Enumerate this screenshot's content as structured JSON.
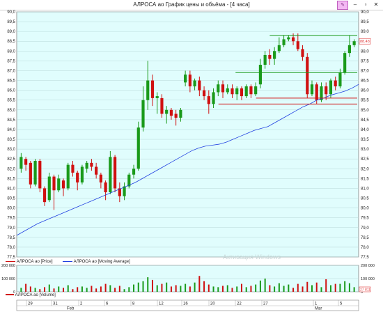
{
  "window": {
    "title": "АЛРОСА ао График цены и объёма - [4 часа]",
    "pin_icon": "pencil-icon",
    "controls": [
      "minimize-icon",
      "restore-icon",
      "close-icon"
    ]
  },
  "colors": {
    "background": "#e0fdfd",
    "bull": "#1a9a1a",
    "bear": "#d01010",
    "ma": "#2040e0",
    "level_green": "#1a9a1a",
    "level_red": "#d01010"
  },
  "chart_data": {
    "type": "candlestick",
    "ylim": [
      77.5,
      90.0
    ],
    "yticks": [
      "90,0",
      "89,5",
      "89,0",
      "88,5",
      "88,0",
      "87,5",
      "87,0",
      "86,5",
      "86,0",
      "85,5",
      "85,0",
      "84,5",
      "84,0",
      "83,5",
      "83,0",
      "82,5",
      "82,0",
      "81,5",
      "81,0",
      "80,5",
      "80,0",
      "79,5",
      "79,0",
      "78,5",
      "78,0",
      "77,5"
    ],
    "last_price_label": "88,48",
    "candles": [
      [
        82.0,
        82.6,
        82.8,
        81.8
      ],
      [
        82.5,
        82.2,
        82.6,
        81.9
      ],
      [
        82.3,
        81.2,
        82.4,
        81.0
      ],
      [
        81.2,
        82.4,
        82.5,
        81.1
      ],
      [
        82.4,
        81.0,
        82.5,
        80.8
      ],
      [
        81.0,
        80.3,
        81.1,
        80.1
      ],
      [
        80.4,
        81.6,
        81.8,
        80.3
      ],
      [
        81.6,
        80.9,
        81.7,
        79.9
      ],
      [
        80.9,
        81.5,
        81.7,
        80.8
      ],
      [
        81.4,
        81.0,
        81.5,
        80.6
      ],
      [
        81.0,
        82.2,
        82.3,
        80.9
      ],
      [
        82.2,
        81.8,
        82.4,
        81.6
      ],
      [
        81.8,
        81.3,
        81.9,
        80.9
      ],
      [
        81.3,
        82.1,
        82.2,
        81.2
      ],
      [
        82.0,
        82.3,
        82.4,
        81.8
      ],
      [
        82.3,
        82.1,
        82.5,
        81.9
      ],
      [
        82.1,
        81.7,
        82.3,
        81.5
      ],
      [
        81.7,
        81.3,
        81.8,
        81.0
      ],
      [
        81.3,
        80.8,
        81.4,
        80.4
      ],
      [
        80.8,
        82.6,
        82.9,
        80.7
      ],
      [
        82.6,
        81.0,
        82.7,
        80.8
      ],
      [
        81.0,
        80.6,
        81.3,
        80.3
      ],
      [
        80.6,
        81.1,
        81.3,
        80.4
      ],
      [
        81.1,
        81.7,
        81.8,
        81.0
      ],
      [
        81.7,
        82.0,
        82.2,
        81.5
      ],
      [
        82.0,
        84.1,
        84.4,
        81.9
      ],
      [
        84.1,
        85.5,
        86.2,
        83.9
      ],
      [
        85.5,
        86.5,
        87.5,
        85.0
      ],
      [
        86.5,
        85.6,
        86.8,
        85.2
      ],
      [
        85.6,
        85.7,
        85.9,
        84.8
      ],
      [
        85.6,
        84.8,
        85.8,
        84.6
      ],
      [
        84.8,
        85.0,
        85.2,
        84.3
      ],
      [
        85.0,
        84.7,
        85.1,
        84.5
      ],
      [
        84.8,
        84.6,
        85.0,
        84.2
      ],
      [
        84.6,
        85.0,
        85.1,
        84.4
      ],
      [
        86.4,
        86.8,
        87.0,
        86.2
      ],
      [
        86.8,
        86.2,
        87.0,
        85.9
      ],
      [
        86.2,
        86.5,
        86.6,
        86.0
      ],
      [
        86.5,
        86.0,
        86.7,
        85.7
      ],
      [
        86.0,
        85.7,
        86.2,
        85.5
      ],
      [
        85.7,
        85.3,
        86.0,
        84.8
      ],
      [
        85.3,
        85.9,
        86.1,
        85.1
      ],
      [
        85.9,
        86.3,
        86.5,
        85.7
      ],
      [
        86.3,
        85.9,
        86.5,
        85.6
      ],
      [
        85.9,
        86.1,
        86.3,
        85.8
      ],
      [
        86.1,
        85.8,
        86.3,
        85.6
      ],
      [
        85.8,
        86.1,
        86.2,
        85.5
      ],
      [
        86.1,
        85.7,
        86.2,
        85.5
      ],
      [
        85.7,
        86.2,
        86.3,
        85.6
      ],
      [
        86.2,
        85.8,
        86.3,
        85.6
      ],
      [
        85.8,
        86.2,
        86.4,
        85.7
      ],
      [
        86.3,
        87.3,
        87.6,
        86.1
      ],
      [
        87.3,
        87.8,
        88.0,
        87.1
      ],
      [
        87.8,
        87.6,
        88.1,
        87.3
      ],
      [
        87.6,
        88.0,
        88.2,
        87.3
      ],
      [
        88.0,
        88.3,
        88.7,
        87.9
      ],
      [
        88.3,
        88.6,
        88.8,
        88.2
      ],
      [
        88.6,
        88.7,
        88.8,
        88.5
      ],
      [
        88.7,
        88.5,
        88.9,
        88.3
      ],
      [
        88.5,
        88.1,
        88.9,
        88.0
      ],
      [
        88.1,
        87.7,
        88.3,
        87.5
      ],
      [
        87.7,
        85.8,
        87.9,
        85.6
      ],
      [
        85.8,
        86.3,
        86.5,
        85.7
      ],
      [
        86.3,
        85.5,
        86.4,
        85.3
      ],
      [
        85.5,
        86.2,
        86.4,
        85.4
      ],
      [
        86.2,
        85.8,
        86.4,
        85.5
      ],
      [
        85.8,
        86.5,
        86.6,
        85.6
      ],
      [
        86.5,
        86.2,
        86.7,
        86.0
      ],
      [
        86.2,
        86.9,
        87.1,
        86.1
      ],
      [
        86.9,
        87.9,
        88.0,
        86.8
      ],
      [
        87.9,
        88.3,
        88.8,
        87.7
      ],
      [
        88.3,
        88.5,
        88.6,
        88.2
      ]
    ],
    "moving_average": [
      78.6,
      78.8,
      79.0,
      79.2,
      79.35,
      79.5,
      79.65,
      79.8,
      79.95,
      80.1,
      80.25,
      80.4,
      80.55,
      80.7,
      80.85,
      81.0,
      81.15,
      81.3,
      81.5,
      81.7,
      81.9,
      82.1,
      82.3,
      82.5,
      82.7,
      82.9,
      83.05,
      83.15,
      83.2,
      83.25,
      83.35,
      83.5,
      83.65,
      83.8,
      83.95,
      84.05,
      84.15,
      84.35,
      84.55,
      84.75,
      84.95,
      85.15,
      85.3,
      85.5,
      85.6,
      85.75,
      85.85,
      85.95,
      86.1,
      86.3
    ],
    "levels": [
      {
        "y": 88.8,
        "from": 0.74,
        "color": "green"
      },
      {
        "y": 86.9,
        "from": 0.64,
        "color": "green"
      },
      {
        "y": 85.6,
        "from": 0.7,
        "color": "red"
      },
      {
        "y": 85.3,
        "from": 0.59,
        "color": "red"
      }
    ],
    "volume": {
      "ylim": [
        0,
        200000
      ],
      "yticks": [
        "200 000",
        "100 000",
        "0"
      ],
      "last_label": "27 811",
      "values": [
        30,
        60,
        40,
        30,
        20,
        35,
        55,
        25,
        40,
        30,
        50,
        20,
        35,
        40,
        30,
        45,
        25,
        40,
        60,
        50,
        30,
        45,
        20,
        35,
        55,
        70,
        80,
        110,
        90,
        50,
        60,
        70,
        40,
        50,
        45,
        60,
        40,
        70,
        120,
        80,
        55,
        40,
        35,
        45,
        50,
        30,
        40,
        60,
        35,
        45,
        55,
        85,
        100,
        50,
        40,
        65,
        45,
        55,
        30,
        60,
        40,
        75,
        50,
        70,
        35,
        95,
        50,
        60,
        60,
        80,
        65,
        35
      ]
    },
    "x_labels": [
      "29",
      "31",
      "2",
      "6",
      "8",
      "12",
      "16",
      "20",
      "22",
      "27",
      "1",
      "5"
    ],
    "month_labels": [
      "Feb",
      "Mar"
    ]
  },
  "legend": {
    "price": "АЛРОСА ао [Price]",
    "ma": "АЛРОСА ао [Moving Average]",
    "volume": "АЛРОСА ао [Volume]"
  },
  "watermark": "Активация Windows"
}
